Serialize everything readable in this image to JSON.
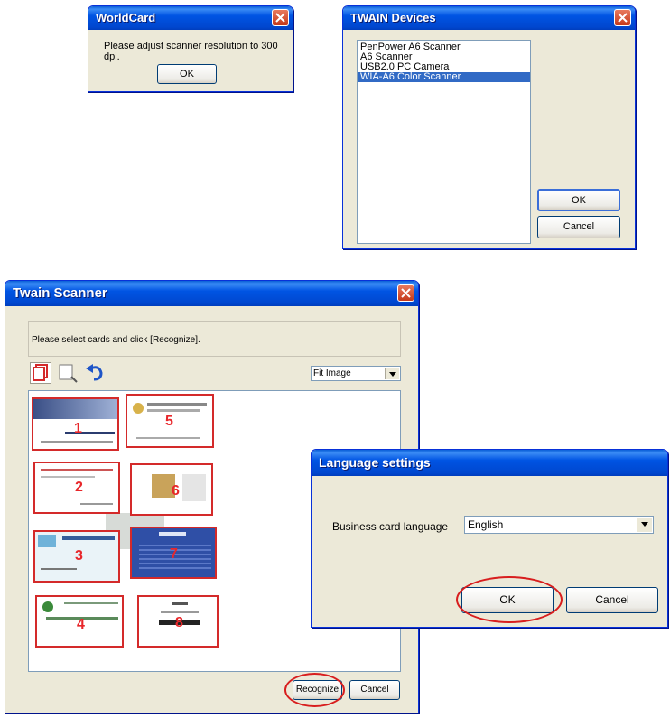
{
  "worldcard": {
    "title": "WorldCard",
    "message": "Please adjust scanner resolution to 300 dpi.",
    "ok": "OK"
  },
  "twain_devices": {
    "title": "TWAIN Devices",
    "devices": [
      "PenPower A6 Scanner",
      "A6 Scanner",
      "USB2.0 PC Camera",
      "WIA-A6 Color Scanner"
    ],
    "selected_index": 3,
    "ok": "OK",
    "cancel": "Cancel"
  },
  "twain_scanner": {
    "title": "Twain Scanner",
    "instruction": "Please select cards and click [Recognize].",
    "fit_option": "Fit Image",
    "card_numbers": [
      "1",
      "2",
      "3",
      "4",
      "5",
      "6",
      "7",
      "8"
    ],
    "recognize": "Recognize",
    "cancel": "Cancel"
  },
  "language_settings": {
    "title": "Language settings",
    "label": "Business card language",
    "value": "English",
    "ok": "OK",
    "cancel": "Cancel"
  },
  "colors": {
    "titlebar": "#0054e3",
    "dialog_bg": "#ece9d8",
    "highlight": "#d81e1e",
    "selection": "#316ac5"
  }
}
